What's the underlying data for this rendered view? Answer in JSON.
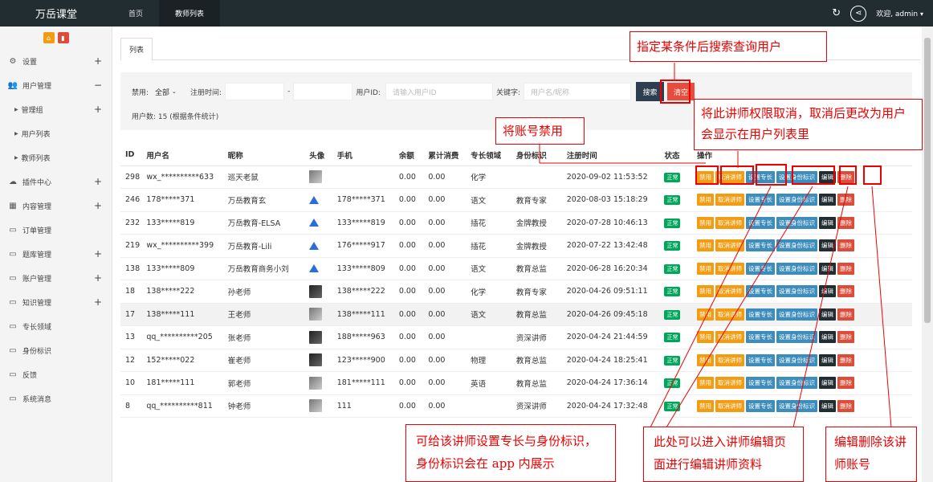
{
  "app": {
    "logo": "万岳课堂",
    "welcome": "欢迎, admin",
    "caret": "▾"
  },
  "topnav": [
    {
      "label": "首页",
      "active": false
    },
    {
      "label": "教师列表",
      "active": true
    }
  ],
  "sidebar": [
    {
      "label": "设置",
      "icon": "gear-icon",
      "plus": "+",
      "sub": false
    },
    {
      "label": "用户管理",
      "icon": "users-icon",
      "plus": "−",
      "sub": false
    },
    {
      "label": "管理组",
      "icon": "",
      "plus": "+",
      "sub": true
    },
    {
      "label": "用户列表",
      "icon": "",
      "plus": "",
      "sub": true
    },
    {
      "label": "教师列表",
      "icon": "",
      "plus": "",
      "sub": true
    },
    {
      "label": "插件中心",
      "icon": "cloud-icon",
      "plus": "+",
      "sub": false
    },
    {
      "label": "内容管理",
      "icon": "grid-icon",
      "plus": "+",
      "sub": false
    },
    {
      "label": "订单管理",
      "icon": "monitor-icon",
      "plus": "",
      "sub": false
    },
    {
      "label": "题库管理",
      "icon": "monitor-icon",
      "plus": "+",
      "sub": false
    },
    {
      "label": "账户管理",
      "icon": "monitor-icon",
      "plus": "+",
      "sub": false
    },
    {
      "label": "知识管理",
      "icon": "monitor-icon",
      "plus": "+",
      "sub": false
    },
    {
      "label": "专长领域",
      "icon": "monitor-icon",
      "plus": "",
      "sub": false
    },
    {
      "label": "身份标识",
      "icon": "monitor-icon",
      "plus": "",
      "sub": false
    },
    {
      "label": "反馈",
      "icon": "monitor-icon",
      "plus": "",
      "sub": false
    },
    {
      "label": "系统消息",
      "icon": "monitor-icon",
      "plus": "",
      "sub": false
    }
  ],
  "tab": {
    "label": "列表"
  },
  "filter": {
    "ban_label": "禁用:",
    "ban_value": "全部",
    "reg_label": "注册时间:",
    "dash": "-",
    "uid_label": "用户ID:",
    "uid_placeholder": "请输入用户ID",
    "kw_label": "关键字:",
    "kw_placeholder": "用户名/昵称",
    "search": "搜索",
    "clear": "清空",
    "count": "用户数: 15 (根据条件统计)"
  },
  "table": {
    "headers": [
      "ID",
      "用户名",
      "昵称",
      "头像",
      "手机",
      "余额",
      "累计消费",
      "专长领域",
      "身份标识",
      "注册时间",
      "状态",
      "操作"
    ],
    "status": "正常",
    "ops": {
      "ban": "禁用",
      "cancel": "取消讲师",
      "spec": "设置专长",
      "ident": "设置身份标识",
      "edit": "编辑",
      "del": "删除"
    },
    "rows": [
      {
        "id": "298",
        "user": "wx_**********633",
        "nick": "巡天老鼠",
        "avatar": "photo",
        "phone": "",
        "bal": "0.00",
        "spent": "0.00",
        "field": "化学",
        "ident": "",
        "time": "2020-09-02 11:53:52"
      },
      {
        "id": "246",
        "user": "178*****371",
        "nick": "万岳教育玄",
        "avatar": "tri",
        "phone": "178*****371",
        "bal": "0.00",
        "spent": "0.00",
        "field": "语文",
        "ident": "教育专家",
        "time": "2020-08-03 15:18:29"
      },
      {
        "id": "232",
        "user": "133*****819",
        "nick": "万岳教育-ELSA",
        "avatar": "tri",
        "phone": "133*****819",
        "bal": "0.00",
        "spent": "0.00",
        "field": "插花",
        "ident": "金牌教授",
        "time": "2020-07-28 10:46:13"
      },
      {
        "id": "219",
        "user": "wx_**********399",
        "nick": "万岳教育-Lili",
        "avatar": "tri",
        "phone": "176*****917",
        "bal": "0.00",
        "spent": "0.00",
        "field": "插花",
        "ident": "金牌教授",
        "time": "2020-07-22 13:42:48"
      },
      {
        "id": "138",
        "user": "133*****809",
        "nick": "万岳教育商务小刘",
        "avatar": "tri",
        "phone": "133*****809",
        "bal": "0.00",
        "spent": "0.00",
        "field": "语文",
        "ident": "教育总监",
        "time": "2020-06-28 16:20:34"
      },
      {
        "id": "18",
        "user": "138*****222",
        "nick": "孙老师",
        "avatar": "dark",
        "phone": "138*****222",
        "bal": "0.00",
        "spent": "0.00",
        "field": "化学",
        "ident": "教育专家",
        "time": "2020-04-26 09:51:11"
      },
      {
        "id": "17",
        "user": "138*****111",
        "nick": "王老师",
        "avatar": "photo",
        "phone": "138*****111",
        "bal": "0.00",
        "spent": "0.00",
        "field": "语文",
        "ident": "教育总监",
        "time": "2020-04-26 09:45:18"
      },
      {
        "id": "13",
        "user": "qq_**********205",
        "nick": "张老师",
        "avatar": "dark",
        "phone": "188*****963",
        "bal": "0.00",
        "spent": "0.00",
        "field": "",
        "ident": "资深讲师",
        "time": "2020-04-24 21:44:59"
      },
      {
        "id": "12",
        "user": "152*****022",
        "nick": "崔老师",
        "avatar": "dark",
        "phone": "123*****900",
        "bal": "0.00",
        "spent": "0.00",
        "field": "物理",
        "ident": "教育总监",
        "time": "2020-04-24 18:25:41"
      },
      {
        "id": "10",
        "user": "181*****111",
        "nick": "郭老师",
        "avatar": "photo",
        "phone": "181*****111",
        "bal": "0.00",
        "spent": "0.00",
        "field": "英语",
        "ident": "教育总监",
        "time": "2020-04-24 17:36:14"
      },
      {
        "id": "8",
        "user": "qq_**********811",
        "nick": "钟老师",
        "avatar": "photo",
        "phone": "111",
        "bal": "0.00",
        "spent": "0.00",
        "field": "",
        "ident": "资深讲师",
        "time": "2020-04-24 17:32:48"
      }
    ]
  },
  "annotations": {
    "search": "指定某条件后搜索查询用户",
    "cancel": "将此讲师权限取消，取消后更改为用户会显示在用户列表里",
    "ban": "将账号禁用",
    "spec": "可给该讲师设置专长与身份标识，身份标识会在 app 内展示",
    "edit": "此处可以进入讲师编辑页面进行编辑讲师资料",
    "del": "编辑删除该讲师账号"
  }
}
